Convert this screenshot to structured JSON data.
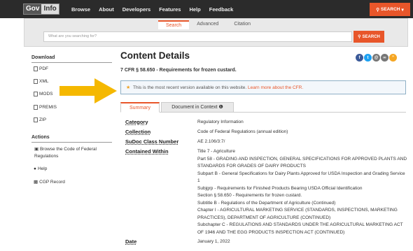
{
  "nav": {
    "logo_gov": "Gov",
    "logo_info": "Info",
    "links": [
      "Browse",
      "About",
      "Developers",
      "Features",
      "Help",
      "Feedback"
    ],
    "search_button": "SEARCH"
  },
  "search": {
    "tabs": [
      "Search",
      "Advanced",
      "Citation"
    ],
    "placeholder": "What are you searching for?",
    "button": "SEARCH"
  },
  "sidebar": {
    "download_heading": "Download",
    "downloads": [
      "PDF",
      "XML",
      "MODS",
      "PREMIS",
      "ZIP"
    ],
    "actions_heading": "Actions",
    "actions": [
      "Browse the Code of Federal Regulations",
      "Help",
      "CGP Record"
    ]
  },
  "main": {
    "title": "Content Details",
    "subtitle": "7 CFR § 58.650 - Requirements for frozen custard.",
    "alert_text": "This is the most recent version available on this website.",
    "alert_link": "Learn more about the CFR.",
    "tabs": [
      "Summary",
      "Document in Context"
    ],
    "details": [
      {
        "label": "Category",
        "value": "Regulatory Information"
      },
      {
        "label": "Collection",
        "value": "Code of Federal Regulations (annual edition)"
      },
      {
        "label": "SuDoc Class Number",
        "value": "AE 2.106/3:7/"
      },
      {
        "label": "Contained Within",
        "values": [
          "Title 7 - Agriculture",
          "Part 58 - GRADING AND INSPECTION, GENERAL SPECIFICATIONS FOR APPROVED PLANTS AND STANDARDS FOR GRADES OF DAIRY PRODUCTS",
          "Subpart B - General Specifications for Dairy Plants Approved for USDA Inspection and Grading Service 1",
          "Subjgrp - Requirements for Finished Products Bearing USDA Official Identification",
          "Section § 58.650 - Requirements for frozen custard.",
          "Subtitle B - Regulations of the Department of Agriculture (Continued)",
          "Chapter I - AGRICULTURAL MARKETING SERVICE (STANDARDS, INSPECTIONS, MARKETING PRACTICES), DEPARTMENT OF AGRICULTURE (CONTINUED)",
          "Subchapter C - REGULATIONS AND STANDARDS UNDER THE AGRICULTURAL MARKETING ACT OF 1946 AND THE EGG PRODUCTS INSPECTION ACT (CONTINUED)"
        ]
      },
      {
        "label": "Date",
        "value": "January 1, 2022"
      }
    ]
  },
  "colors": {
    "accent": "#e8562a",
    "nav_bg": "#2b2b2b",
    "arrow": "#f5b800"
  }
}
